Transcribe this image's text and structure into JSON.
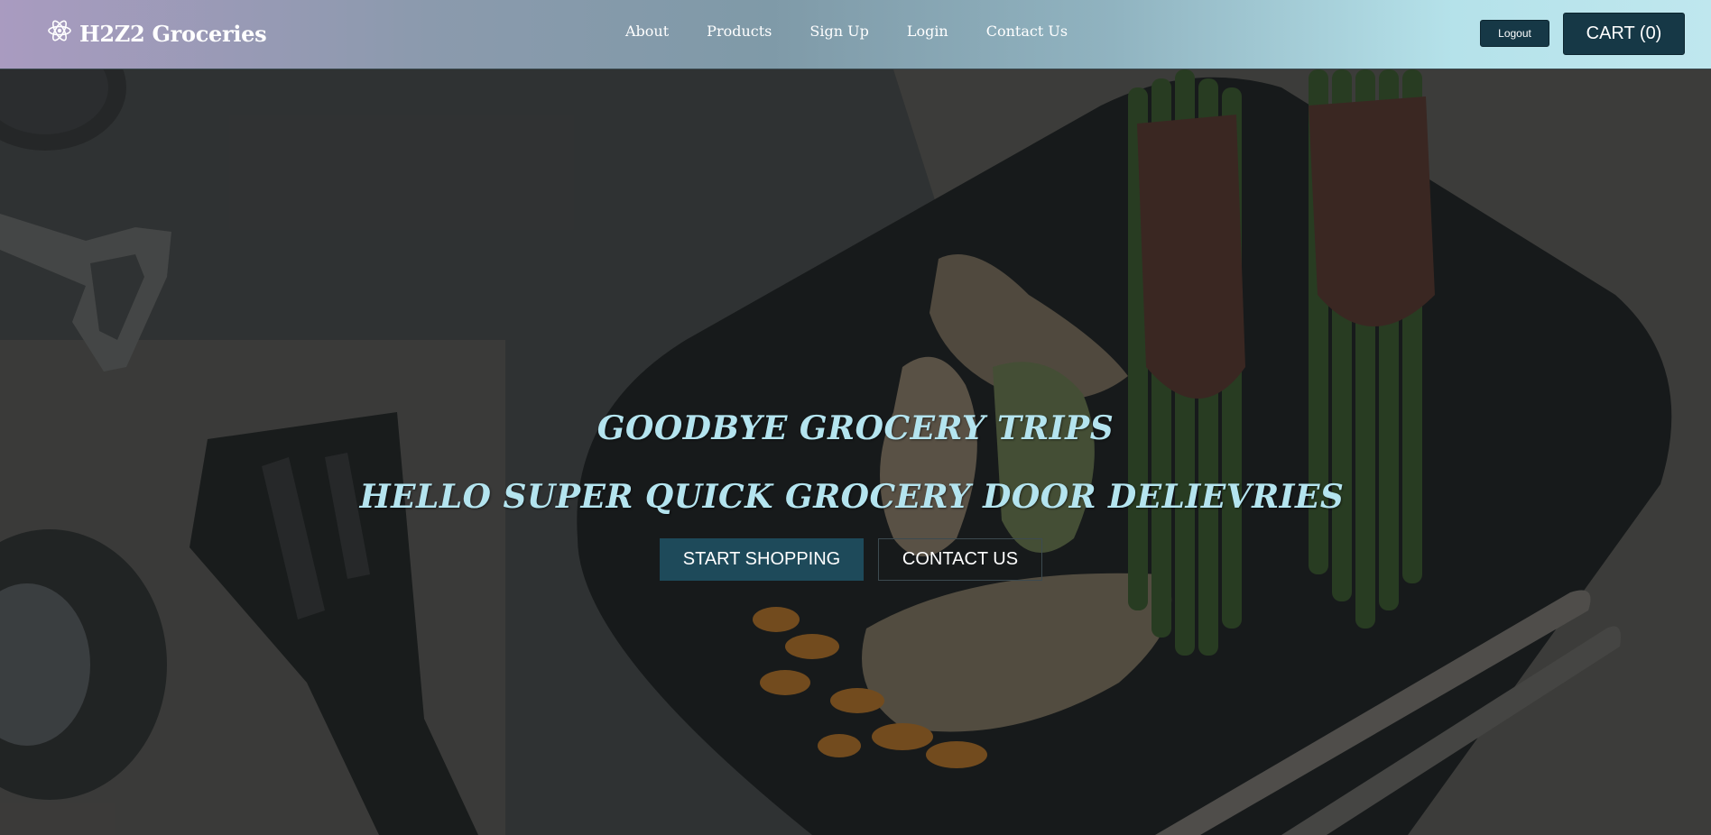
{
  "header": {
    "brand": "H2Z2 Groceries",
    "nav": [
      "About",
      "Products",
      "Sign Up",
      "Login",
      "Contact Us"
    ],
    "logout_label": "Logout",
    "cart_label": "CART (0)"
  },
  "hero": {
    "headline_1": "GOODBYE GROCERY TRIPS",
    "headline_2": "HELLO SUPER QUICK GROCERY DOOR DELIEVRIES",
    "primary_button": "START SHOPPING",
    "secondary_button": "CONTACT US"
  },
  "colors": {
    "accent": "#163846",
    "headline": "#b4e4ef"
  },
  "icons": {
    "brand_icon": "atom-icon"
  }
}
